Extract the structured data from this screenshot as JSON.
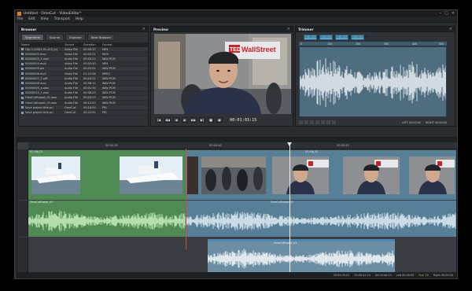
{
  "window": {
    "title": "Untitled - OmeCut - VideoEditor*",
    "controls": [
      "–",
      "□",
      "×"
    ]
  },
  "menu": [
    "File",
    "Edit",
    "View",
    "Transport",
    "Help"
  ],
  "browser": {
    "title": "Browser",
    "tabs": [
      "Segments",
      "Source",
      "Explorer",
      "Beat Browser"
    ],
    "columns": [
      "Name",
      "Source",
      "Duration",
      "Format"
    ],
    "files": [
      {
        "name": "Clip 1 (0001-91-ch3_m)",
        "source": "Video File",
        "duration": "00:09:27",
        "format": "MP4"
      },
      {
        "name": "00000002.mov",
        "source": "Video File",
        "duration": "00:05:21",
        "format": "MOV"
      },
      {
        "name": "00000003_1.wav",
        "source": "Audio File",
        "duration": "00:05:21",
        "format": "WAV PCM"
      },
      {
        "name": "00000004.mp4",
        "source": "Video File",
        "duration": "00:03:43",
        "format": "MP4"
      },
      {
        "name": "00000005.avi",
        "source": "Audio File",
        "duration": "00:02:01",
        "format": "WAV PCM"
      },
      {
        "name": "00000006.mp3",
        "source": "Video File",
        "duration": "01:12:08",
        "format": "MPEG"
      },
      {
        "name": "00000007_1.aiff",
        "source": "Audio File",
        "duration": "00:04:21",
        "format": "WAV PCM"
      },
      {
        "name": "00000008.mov",
        "source": "Audio File",
        "duration": "00:08:11",
        "format": "WAV PCM"
      },
      {
        "name": "00000009_a.wav",
        "source": "Audio File",
        "duration": "00:01:30",
        "format": "WAV PCM"
      },
      {
        "name": "00000010_1.wav",
        "source": "Audio File",
        "duration": "00:06:43",
        "format": "WAV PCM"
      },
      {
        "name": "OmeCutExport_01.wav",
        "source": "Audio File",
        "duration": "00:20:23",
        "format": "WAV PCM"
      },
      {
        "name": "OmeCutExport_02.wav",
        "source": "Audio File",
        "duration": "00:12:03",
        "format": "WAV PCM"
      },
      {
        "name": "Save project title.prj",
        "source": "OmeCut",
        "duration": "00:18:00",
        "format": "PRJ"
      },
      {
        "name": "Save project title.prj",
        "source": "OmeCut",
        "duration": "00:20:51",
        "format": "PRJ"
      }
    ]
  },
  "preview": {
    "title": "Preview",
    "timecode": "00:01:03:15",
    "banner_brand": "TED",
    "banner_text": "WallStreet",
    "controls": [
      "|◀",
      "◀◀",
      "◀",
      "▶",
      "▶▶",
      "▶|",
      "■",
      "●"
    ]
  },
  "trimmer": {
    "title": "Trimmer",
    "boxes": [
      "00:00:01:21",
      "00:00:01:16",
      "00:00:04:09",
      "00:00:05:02"
    ],
    "ruler": [
      "0",
      "100",
      "200",
      "300",
      "400",
      "500"
    ],
    "status": [
      "LEFT 00:00:00",
      "RIGHT 00:00:00"
    ]
  },
  "timeline": {
    "ruler_labels": [
      "00:00:35",
      "00:00:40",
      "00:00:45"
    ],
    "video_clip_labels": [
      "V1 clip_01",
      "V1 clip_02"
    ],
    "audio_clip_labels": [
      "OmeCutExport_01",
      "OmeCutExport_02",
      "OmeCutExport_03"
    ],
    "status": [
      "00:00:35:01",
      "00:00:41:15",
      "00:00:40:23",
      "Left 00:00:00",
      "Right 00:00:00"
    ],
    "status_badge": "Fps: 25"
  },
  "colors": {
    "accent": "#5fa5c9",
    "green_clip": "#4f8a55",
    "blue_clip": "#587f98",
    "window_bg": "#2a2c2f"
  }
}
